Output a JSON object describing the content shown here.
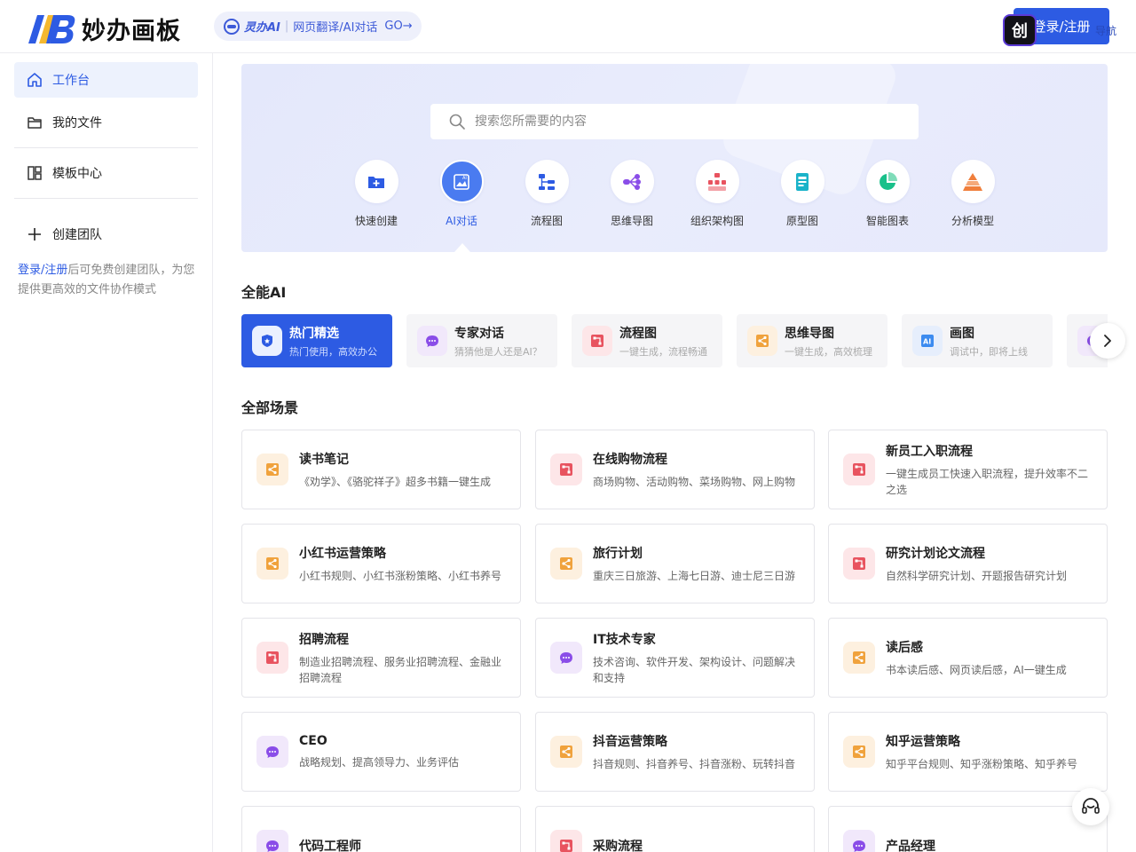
{
  "header": {
    "logo_text": "妙办画板",
    "promo": {
      "brand": "灵办AI",
      "text": "网页翻译/AI对话",
      "go": "GO→"
    },
    "login_label": "登录/注册",
    "tool_badge": "创",
    "nav_badge": "导航"
  },
  "sidebar": {
    "items": [
      {
        "label": "工作台",
        "icon": "home-icon"
      },
      {
        "label": "我的文件",
        "icon": "folder-icon"
      },
      {
        "label": "模板中心",
        "icon": "template-icon"
      }
    ],
    "create_team": "创建团队",
    "hint_link": "登录/注册",
    "hint_text": "后可免费创建团队，为您提供更高效的文件协作模式"
  },
  "hero": {
    "search_placeholder": "搜索您所需要的内容",
    "quick_actions": [
      {
        "label": "快速创建",
        "icon": "folder-plus-icon",
        "color": "#2d5be3"
      },
      {
        "label": "AI对话",
        "icon": "ai-image-icon",
        "color": "#4a7bf0"
      },
      {
        "label": "流程图",
        "icon": "flowchart-icon",
        "color": "#2d5be3"
      },
      {
        "label": "思维导图",
        "icon": "mindmap-icon",
        "color": "#8a4de8"
      },
      {
        "label": "组织架构图",
        "icon": "org-chart-icon",
        "color": "#e8535f"
      },
      {
        "label": "原型图",
        "icon": "prototype-icon",
        "color": "#1ab3c9"
      },
      {
        "label": "智能图表",
        "icon": "pie-chart-icon",
        "color": "#19c08a"
      },
      {
        "label": "分析模型",
        "icon": "pyramid-icon",
        "color": "#f07f3c"
      }
    ]
  },
  "ai_section": {
    "title": "全能AI",
    "categories": [
      {
        "title": "热门精选",
        "desc": "热门使用，高效办公",
        "icon": "hot-badge-icon"
      },
      {
        "title": "专家对话",
        "desc": "猜猜他是人还是AI？",
        "icon": "chat-bubble-icon"
      },
      {
        "title": "流程图",
        "desc": "一键生成，流程畅通",
        "icon": "flow-icon"
      },
      {
        "title": "思维导图",
        "desc": "一键生成，高效梳理",
        "icon": "share-icon"
      },
      {
        "title": "画图",
        "desc": "调试中，即将上线",
        "icon": "ai-image-icon"
      }
    ]
  },
  "scenes": {
    "title": "全部场景",
    "items": [
      {
        "title": "读书笔记",
        "desc": "《劝学》、《骆驼祥子》超多书籍一键生成",
        "type": "orange"
      },
      {
        "title": "在线购物流程",
        "desc": "商场购物、活动购物、菜场购物、网上购物",
        "type": "red"
      },
      {
        "title": "新员工入职流程",
        "desc": "一键生成员工快速入职流程，提升效率不二之选",
        "type": "red"
      },
      {
        "title": "小红书运营策略",
        "desc": "小红书规则、小红书涨粉策略、小红书养号",
        "type": "orange"
      },
      {
        "title": "旅行计划",
        "desc": "重庆三日旅游、上海七日游、迪士尼三日游",
        "type": "orange"
      },
      {
        "title": "研究计划论文流程",
        "desc": "自然科学研究计划、开题报告研究计划",
        "type": "red"
      },
      {
        "title": "招聘流程",
        "desc": "制造业招聘流程、服务业招聘流程、金融业招聘流程",
        "type": "red"
      },
      {
        "title": "IT技术专家",
        "desc": "技术咨询、软件开发、架构设计、问题解决和支持",
        "type": "purple"
      },
      {
        "title": "读后感",
        "desc": "书本读后感、网页读后感，AI一键生成",
        "type": "orange"
      },
      {
        "title": "CEO",
        "desc": "战略规划、提高领导力、业务评估",
        "type": "purple"
      },
      {
        "title": "抖音运营策略",
        "desc": "抖音规则、抖音养号、抖音涨粉、玩转抖音",
        "type": "orange"
      },
      {
        "title": "知乎运营策略",
        "desc": "知乎平台规则、知乎涨粉策略、知乎养号",
        "type": "orange"
      },
      {
        "title": "代码工程师",
        "desc": "",
        "type": "purple"
      },
      {
        "title": "采购流程",
        "desc": "",
        "type": "red"
      },
      {
        "title": "产品经理",
        "desc": "",
        "type": "purple"
      }
    ]
  },
  "colors": {
    "primary": "#2d5be3",
    "orange": "#f0a23c",
    "red": "#e8535f",
    "purple": "#8a4de8"
  }
}
